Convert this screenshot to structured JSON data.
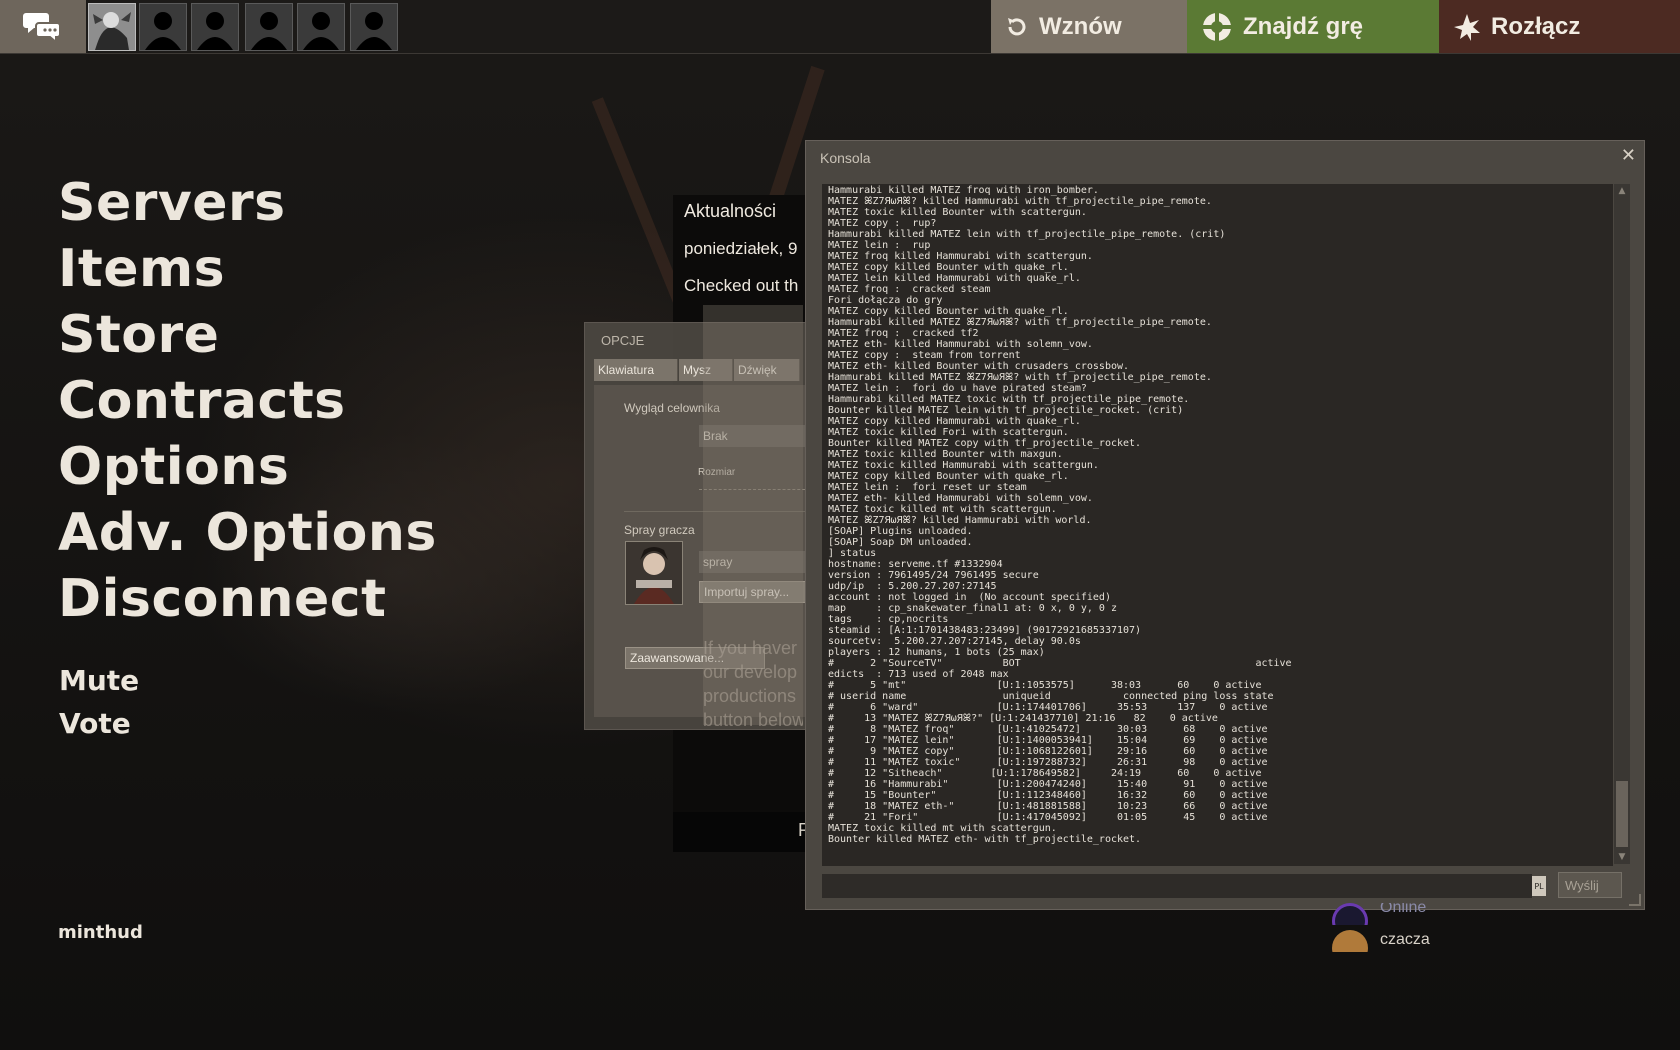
{
  "topbar": {
    "resume_label": "Wznów",
    "find_game_label": "Znajdź grę",
    "disconnect_label": "Rozłącz",
    "colors": {
      "resume": "#7b7266",
      "find_game": "#5b7a34",
      "disconnect": "#4c2a22"
    }
  },
  "main_menu": {
    "items": [
      "Servers",
      "Items",
      "Store",
      "Contracts",
      "Options",
      "Adv. Options",
      "Disconnect"
    ],
    "mute_label": "Mute",
    "vote_label": "Vote",
    "hud_name": "minthud"
  },
  "news": {
    "title": "Aktualności",
    "date": "poniedziałek, 9",
    "headline": "Checked out th",
    "bottom_text": "R"
  },
  "options_dialog": {
    "title": "OPCJE",
    "tabs": [
      "Klawiatura",
      "Mysz",
      "Dźwięk"
    ],
    "crosshair_label": "Wygląd celownika",
    "crosshair_value": "Brak",
    "size_label": "Rozmiar",
    "spray_label": "Spray gracza",
    "spray_value": "spray",
    "import_spray_label": "Importuj spray...",
    "advanced_label": "Zaawansowane...",
    "ghost_text": [
      "If you haver",
      "our develop",
      "productions",
      "button below"
    ]
  },
  "console": {
    "title": "Konsola",
    "send_label": "Wyślij",
    "lang_badge": "PL",
    "log": [
      "Hammurabi killed MATEZ froq with iron_bomber.",
      "MATEZ ꕤZ7ЯωЯꕤ? killed Hammurabi with tf_projectile_pipe_remote.",
      "MATEZ toxic killed Bounter with scattergun.",
      "MATEZ copy :  rup?",
      "Hammurabi killed MATEZ lein with tf_projectile_pipe_remote. (crit)",
      "MATEZ lein :  rup",
      "MATEZ froq killed Hammurabi with scattergun.",
      "MATEZ copy killed Bounter with quake_rl.",
      "MATEZ lein killed Hammurabi with quake_rl.",
      "MATEZ froq :  cracked steam",
      "Fori dołącza do gry",
      "MATEZ copy killed Bounter with quake_rl.",
      "Hammurabi killed MATEZ ꕤZ7ЯωЯꕤ? with tf_projectile_pipe_remote.",
      "MATEZ froq :  cracked tf2",
      "MATEZ eth- killed Hammurabi with solemn_vow.",
      "MATEZ copy :  steam from torrent",
      "MATEZ eth- killed Bounter with crusaders_crossbow.",
      "Hammurabi killed MATEZ ꕤZ7ЯωЯꕤ? with tf_projectile_pipe_remote.",
      "MATEZ lein :  fori do u have pirated steam?",
      "Hammurabi killed MATEZ toxic with tf_projectile_pipe_remote.",
      "Bounter killed MATEZ lein with tf_projectile_rocket. (crit)",
      "MATEZ copy killed Hammurabi with quake_rl.",
      "MATEZ toxic killed Fori with scattergun.",
      "Bounter killed MATEZ copy with tf_projectile_rocket.",
      "MATEZ toxic killed Bounter with maxgun.",
      "MATEZ toxic killed Hammurabi with scattergun.",
      "MATEZ copy killed Bounter with quake_rl.",
      "MATEZ lein :  fori reset ur steam",
      "MATEZ eth- killed Hammurabi with solemn_vow.",
      "MATEZ toxic killed mt with scattergun.",
      "MATEZ ꕤZ7ЯωЯꕤ? killed Hammurabi with world.",
      "[SOAP] Plugins unloaded.",
      "[SOAP] Soap DM unloaded.",
      "] status",
      "hostname: serveme.tf #1332904",
      "version : 7961495/24 7961495 secure",
      "udp/ip  : 5.200.27.207:27145",
      "account : not logged in  (No account specified)",
      "map     : cp_snakewater_final1 at: 0 x, 0 y, 0 z",
      "tags    : cp,nocrits",
      "steamid : [A:1:1701438483:23499] (90172921685337107)",
      "sourcetv:  5.200.27.207:27145, delay 90.0s",
      "players : 12 humans, 1 bots (25 max)",
      "#      2 \"SourceTV\"          BOT                                       active",
      "edicts  : 713 used of 2048 max",
      "#      5 \"mt\"               [U:1:1053575]      38:03      60    0 active",
      "# userid name                uniqueid            connected ping loss state",
      "#      6 \"ward\"             [U:1:174401706]     35:53     137    0 active",
      "#     13 \"MATEZ ꕤZ7ЯωЯꕤ?\" [U:1:241437710] 21:16   82    0 active",
      "#      8 \"MATEZ froq\"       [U:1:41025472]      30:03      68    0 active",
      "#     17 \"MATEZ lein\"       [U:1:1400053941]    15:04      69    0 active",
      "#      9 \"MATEZ copy\"       [U:1:1068122601]    29:16      60    0 active",
      "#     11 \"MATEZ toxic\"      [U:1:197288732]     26:31      98    0 active",
      "#     12 \"Sitheach\"        [U:1:178649582]     24:19      60    0 active",
      "#     16 \"Hammurabi\"        [U:1:200474240]     15:40      91    0 active",
      "#     15 \"Bounter\"          [U:1:112348460]     16:32      60    0 active",
      "#     18 \"MATEZ eth-\"       [U:1:481881588]     10:23      66    0 active",
      "#     21 \"Fori\"             [U:1:417045092]     01:05      45    0 active",
      "MATEZ toxic killed mt with scattergun.",
      "Bounter killed MATEZ eth- with tf_projectile_rocket."
    ]
  },
  "friends": {
    "items": [
      {
        "name": "Online",
        "color": "#6a6a8a"
      },
      {
        "name": "czacza",
        "color": "#d8d2c8"
      }
    ]
  }
}
